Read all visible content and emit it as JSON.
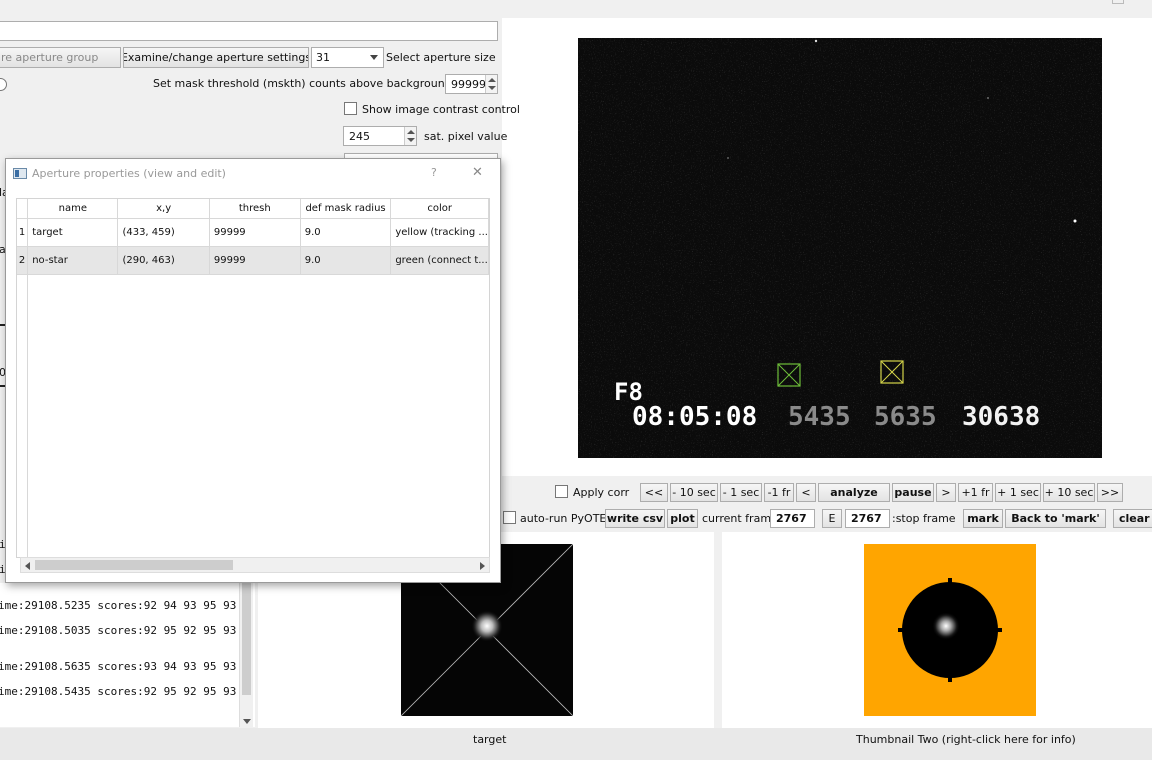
{
  "top": {
    "aperture_group_button": "re aperture group",
    "examine_button": "Examine/change aperture settings",
    "aperture_size_value": "31",
    "aperture_size_label": "Select aperture size",
    "mask_threshold_label": "Set mask threshold (mskth) counts above background (bkavg)",
    "mask_threshold_value": "99999",
    "contrast_label": "Show image contrast control",
    "sat_value": "245",
    "sat_label": "sat. pixel value"
  },
  "left_stub_labels": [
    "la",
    "al",
    "0"
  ],
  "dialog": {
    "title": "Aperture properties (view and edit)",
    "help": "?",
    "close": "✕",
    "columns": [
      "name",
      "x,y",
      "thresh",
      "def mask radius",
      "color"
    ],
    "rows": [
      {
        "num": "1",
        "name": "target",
        "xy": "(433, 459)",
        "thresh": "99999",
        "radius": "9.0",
        "color": "yellow (tracking ..."
      },
      {
        "num": "2",
        "name": "no-star",
        "xy": "(290, 463)",
        "thresh": "99999",
        "radius": "9.0",
        "color": "green (connect t..."
      }
    ]
  },
  "video_overlay": {
    "field_label": "F8",
    "time": "08:05:08",
    "num1": "5435",
    "num2": "5635",
    "num3": "30638"
  },
  "controls": {
    "apply_corr": "Apply corr",
    "nav1": [
      "<<",
      "- 10 sec",
      "- 1 sec",
      "-1 fr",
      "<"
    ],
    "analyze": "analyze",
    "pause": "pause",
    "nav2": [
      ">",
      "+1 fr",
      "+ 1 sec",
      "+ 10 sec",
      ">>"
    ],
    "auto_run": "auto-run PyOTE",
    "write_csv": "write csv",
    "plot": "plot",
    "current_frame_label": "current frame:",
    "current_frame_value": "2767",
    "e_button": "E",
    "stop_frame_value": "2767",
    "stop_frame_label": ":stop frame",
    "mark": "mark",
    "back_to_mark": "Back to 'mark'",
    "clear": "clear d"
  },
  "log_lines": [
    "ime:29108.5235  scores:92 94 93 95 93",
    "ime:29108.5035  scores:92 95 92 95 93",
    "ime:29108.5635  scores:93 94 93 95 93",
    "ime:29108.5435  scores:92 95 92 95 93"
  ],
  "left_fragment": "i",
  "thumbnails": {
    "thumb1_label": "target",
    "thumb2_label": "Thumbnail Two (right-click here for info)",
    "thumb2_bg": "#ffa500"
  },
  "colors": {
    "target_aperture": "#d4d44a",
    "nostar_aperture": "#6fbf3a",
    "orange": "#ffa500"
  }
}
